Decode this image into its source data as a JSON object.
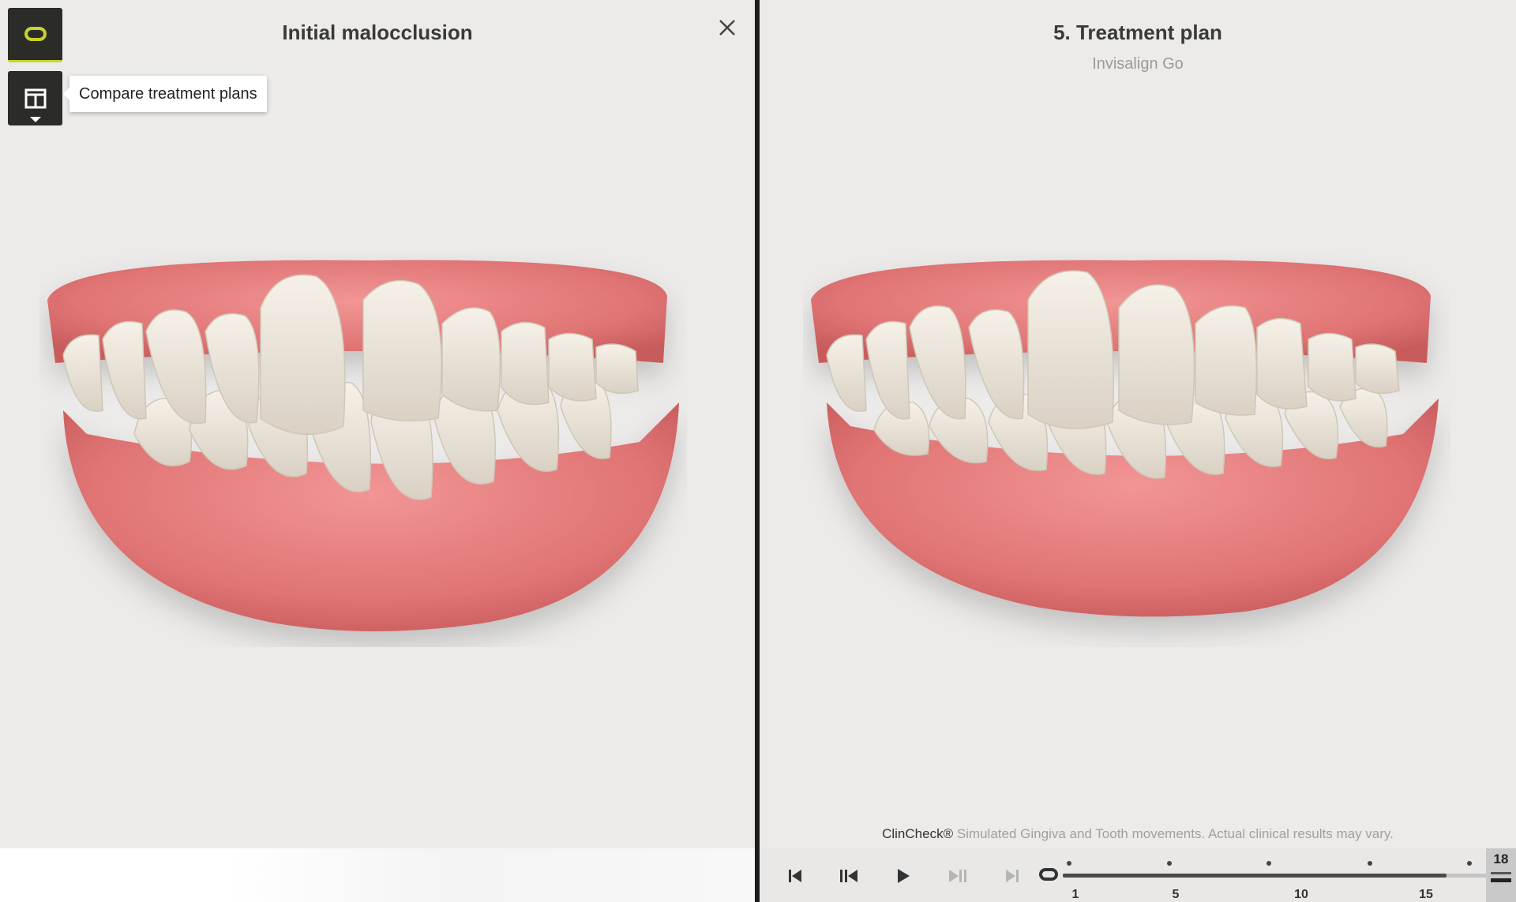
{
  "left_panel": {
    "title": "Initial malocclusion",
    "tooltip": "Compare treatment plans",
    "toolbar": [
      {
        "icon": "single-view-icon",
        "accent": "#c7d42b"
      },
      {
        "icon": "split-view-icon"
      }
    ],
    "close_icon": "close-icon"
  },
  "right_panel": {
    "title": "5. Treatment plan",
    "subtitle": "Invisalign Go",
    "disclaimer_brand": "ClinCheck®",
    "disclaimer_text": " Simulated Gingiva and Tooth movements. Actual clinical results may vary.",
    "controls": [
      "skip-to-start-icon",
      "step-back-icon",
      "play-icon",
      "step-forward-icon",
      "skip-to-end-icon"
    ],
    "timeline": {
      "labels": [
        "1",
        "5",
        "10",
        "15"
      ],
      "current_stage": "18",
      "progress": 0.9
    }
  },
  "colors": {
    "gum": "#e57c7c",
    "tooth": "#ece6da",
    "toolbar_bg": "#2b2b28",
    "accent": "#c7d42b"
  }
}
